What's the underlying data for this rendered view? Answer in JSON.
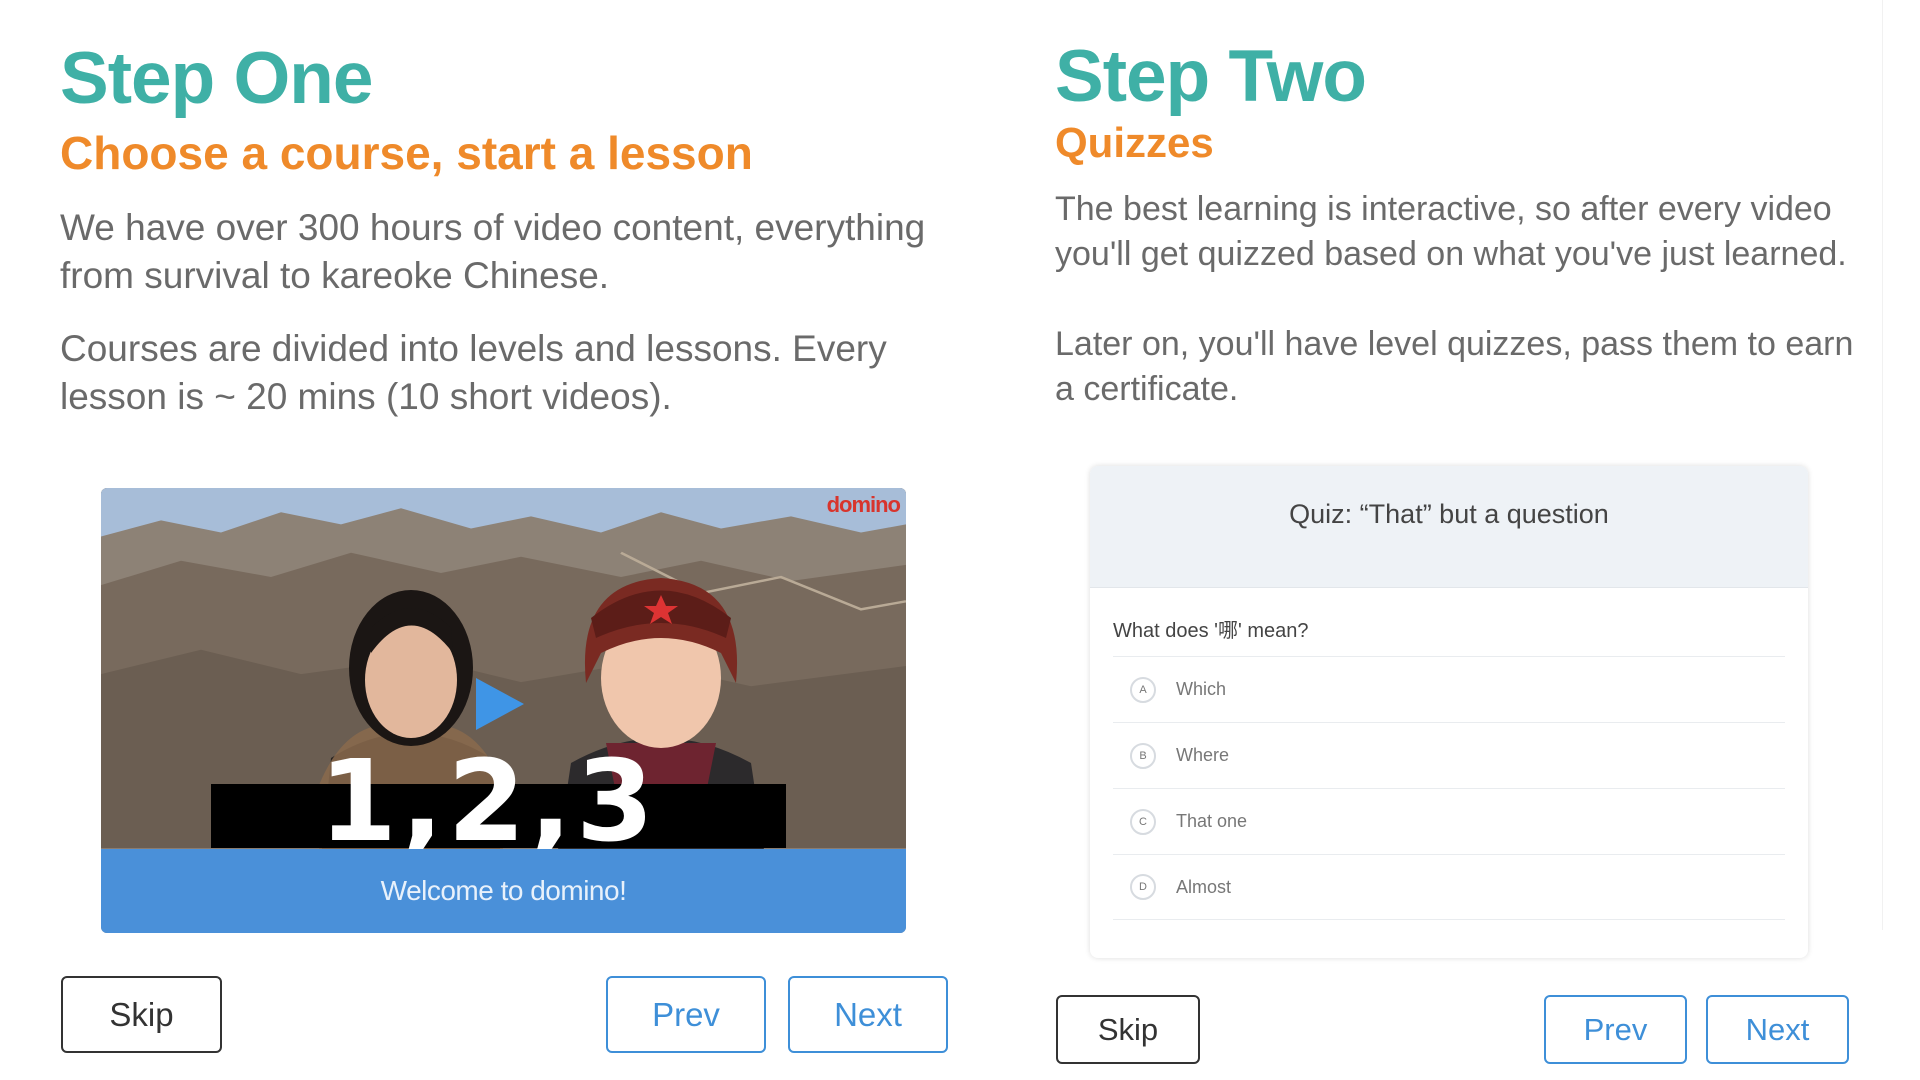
{
  "step_one": {
    "title": "Step One",
    "subtitle": "Choose a course, start a lesson",
    "paragraph_1": "We have over 300 hours of video content, everything from survival to kareoke Chinese.",
    "paragraph_2": "Courses are divided into levels and lessons. Every lesson is ~ 20 mins (10 short videos).",
    "video": {
      "logo": "domino",
      "counter": "1,2,3",
      "caption": "Welcome to domino!"
    },
    "buttons": {
      "skip": "Skip",
      "prev": "Prev",
      "next": "Next"
    }
  },
  "step_two": {
    "title": "Step Two",
    "subtitle": "Quizzes",
    "paragraph_1": "The best learning is interactive, so after every video you'll get quizzed based on what you've just learned.",
    "paragraph_2": "Later on, you'll have level quizzes, pass them to earn a certificate.",
    "quiz": {
      "title": "Quiz: “That” but a question",
      "question": "What does '哪' mean?",
      "options": [
        {
          "letter": "A",
          "label": "Which"
        },
        {
          "letter": "B",
          "label": "Where"
        },
        {
          "letter": "C",
          "label": "That one"
        },
        {
          "letter": "D",
          "label": "Almost"
        }
      ]
    },
    "buttons": {
      "skip": "Skip",
      "prev": "Prev",
      "next": "Next"
    }
  },
  "colors": {
    "title": "#3fb0a6",
    "subtitle": "#ef8a2a",
    "button_blue": "#3e8fd8",
    "caption_bar": "#4a90d9"
  },
  "icons": {
    "play": "play-icon"
  }
}
